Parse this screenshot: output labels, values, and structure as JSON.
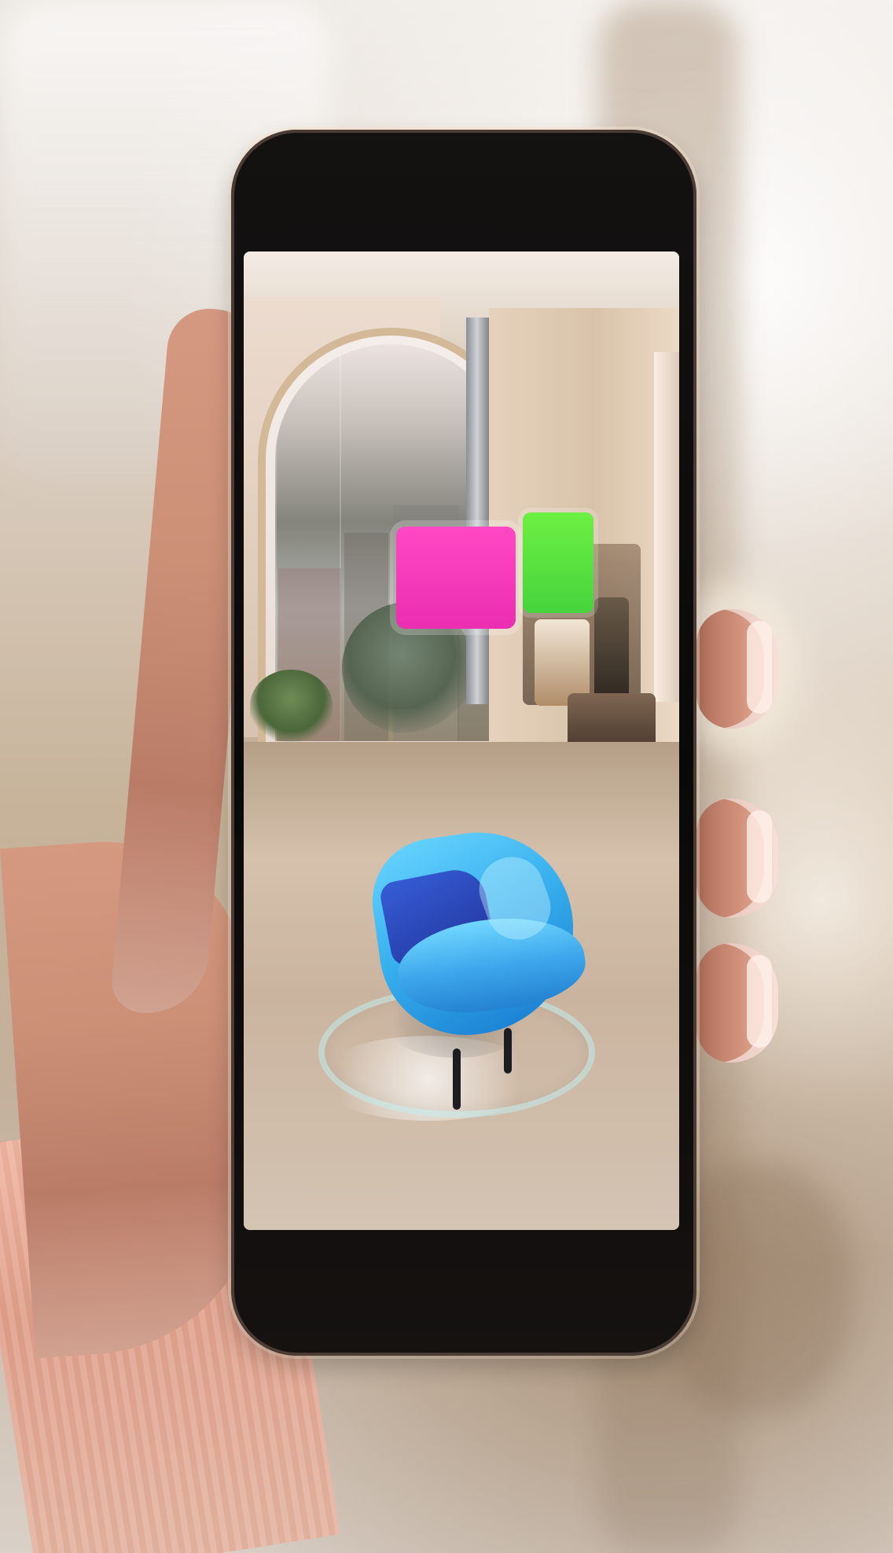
{
  "scene": {
    "accent_colors": {
      "chair_blue": "#38b0ee",
      "sign_pink": "#eb2db2",
      "sign_green": "#46d33c"
    }
  }
}
